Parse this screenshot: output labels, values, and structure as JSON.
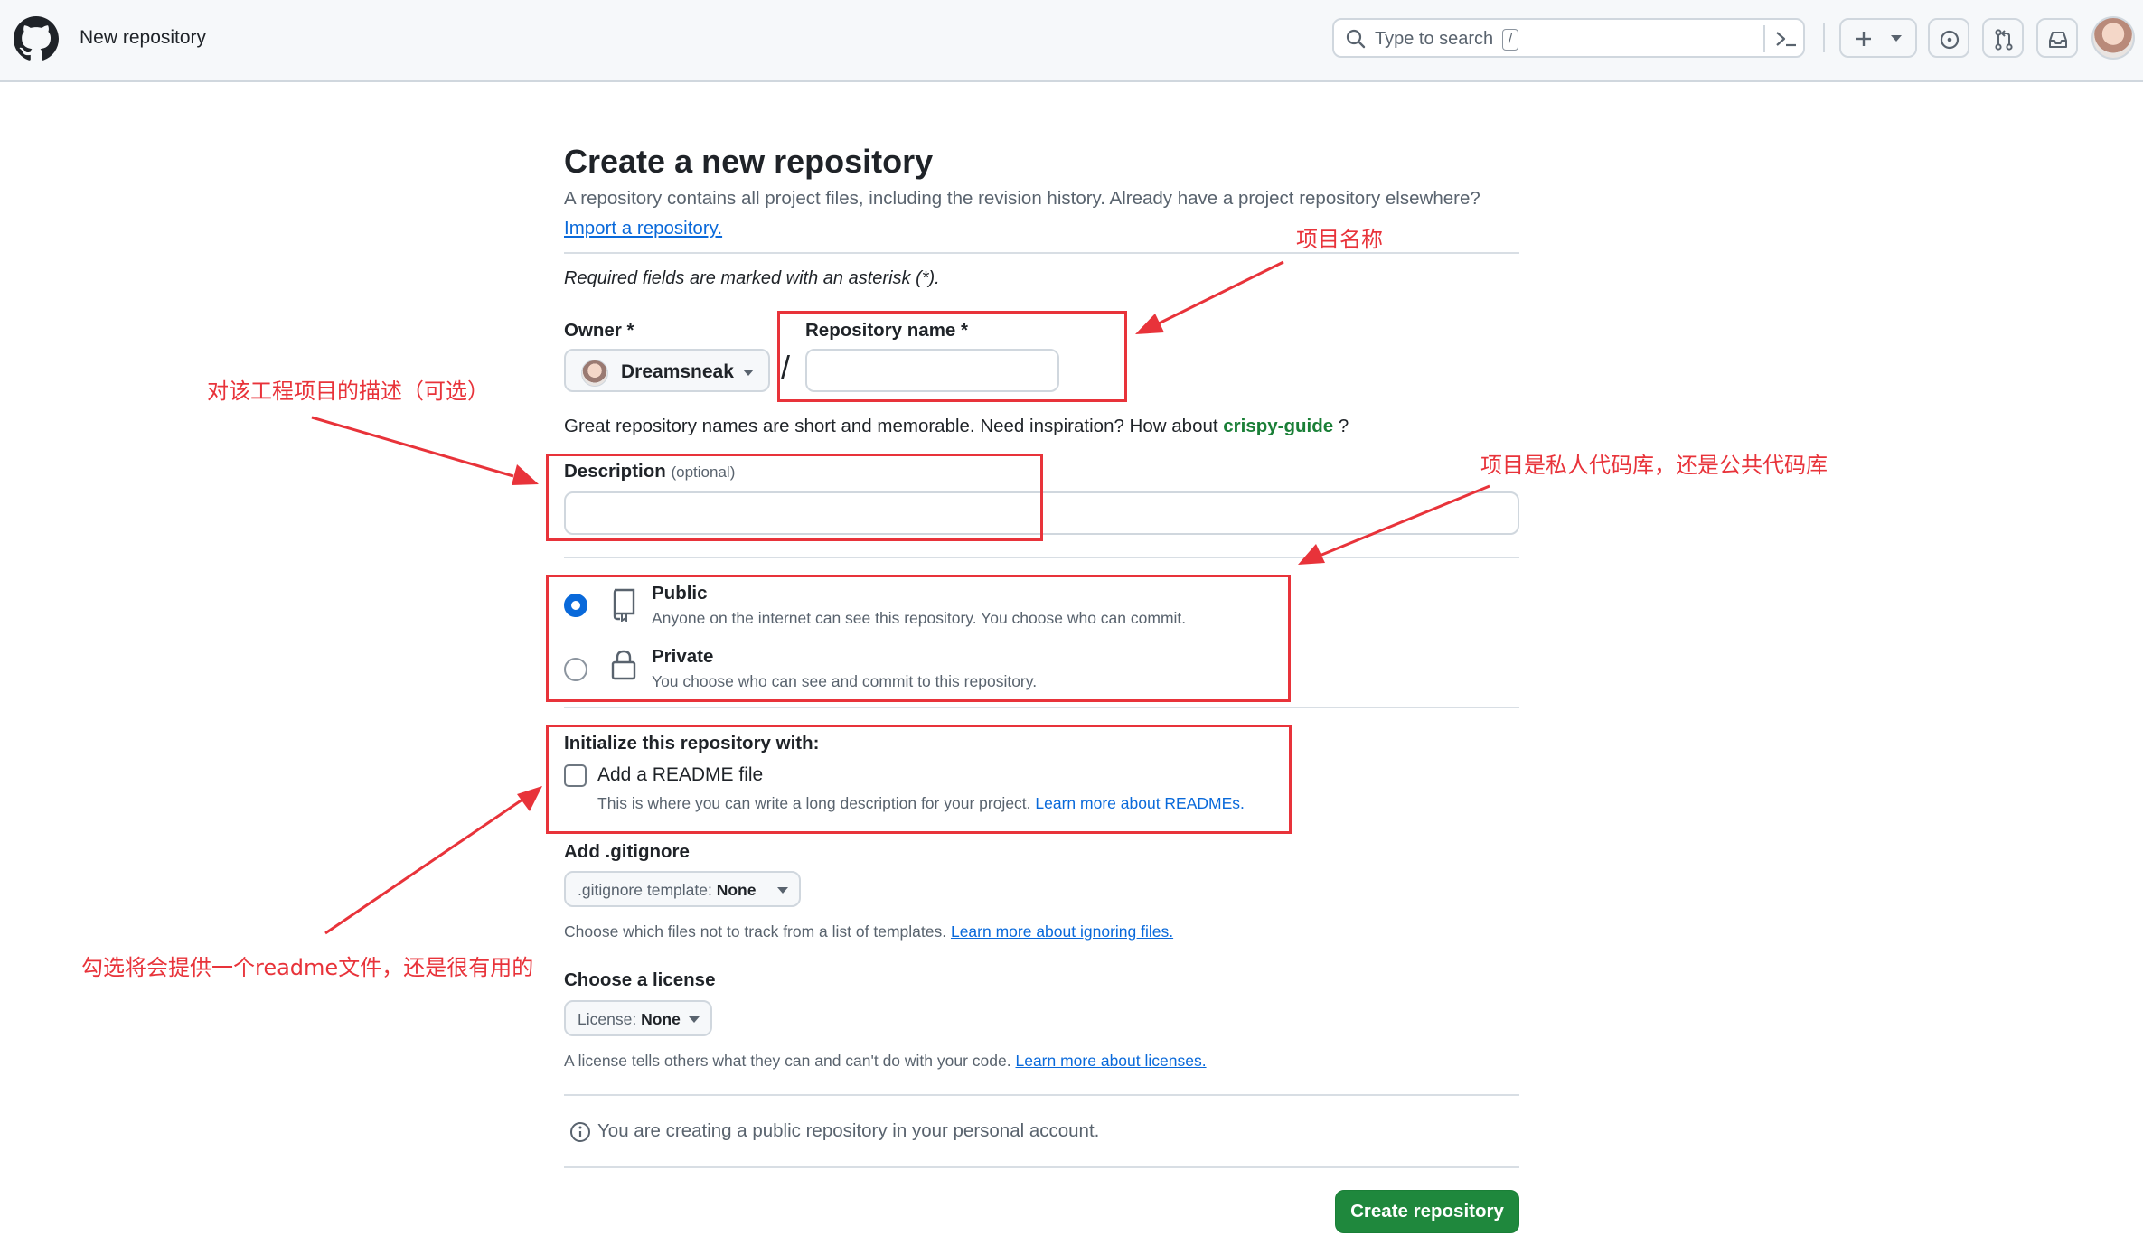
{
  "header": {
    "title": "New repository",
    "search_placeholder": "Type to search",
    "search_shortcut": "/"
  },
  "page": {
    "heading": "Create a new repository",
    "subtitle": "A repository contains all project files, including the revision history. Already have a project repository elsewhere?",
    "import_link": "Import a repository.",
    "required_note": "Required fields are marked with an asterisk (*).",
    "owner_label": "Owner *",
    "owner_value": "Dreamsneak",
    "slash": "/",
    "repo_name_label": "Repository name *",
    "repo_name_value": "",
    "hint_text": "Great repository names are short and memorable. Need inspiration? How about",
    "hint_suggestion": "crispy-guide",
    "hint_end": "?",
    "description_label": "Description",
    "description_optional": "(optional)",
    "description_value": "",
    "visibility": {
      "public_title": "Public",
      "public_desc": "Anyone on the internet can see this repository. You choose who can commit.",
      "private_title": "Private",
      "private_desc": "You choose who can see and commit to this repository.",
      "selected": "Public"
    },
    "init_label": "Initialize this repository with:",
    "readme_label": "Add a README file",
    "readme_checked": false,
    "readme_desc": "This is where you can write a long description for your project.",
    "readme_link": "Learn more about READMEs.",
    "gitignore_label": "Add .gitignore",
    "gitignore_select_prefix": ".gitignore template:",
    "gitignore_select_value": "None",
    "gitignore_desc": "Choose which files not to track from a list of templates.",
    "gitignore_link": "Learn more about ignoring files.",
    "license_label": "Choose a license",
    "license_select_prefix": "License:",
    "license_select_value": "None",
    "license_desc": "A license tells others what they can and can't do with your code.",
    "license_link": "Learn more about licenses.",
    "notice": "You are creating a public repository in your personal account.",
    "create_button": "Create repository"
  },
  "annotations": {
    "repo_name_note": "项目名称",
    "description_note": "对该工程项目的描述（可选）",
    "visibility_note": "项目是私人代码库，还是公共代码库",
    "readme_note": "勾选将会提供一个readme文件，还是很有用的",
    "color": "#e8333a"
  },
  "colors": {
    "accent": "#0969da",
    "primary_button": "#1f883d",
    "suggestion": "#1a7f37"
  }
}
